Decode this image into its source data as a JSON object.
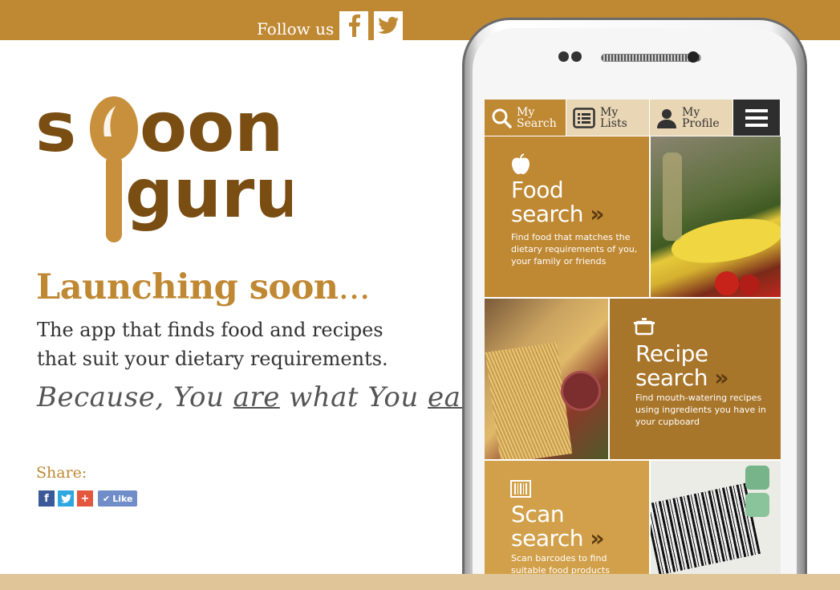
{
  "header": {
    "follow_label": "Follow us",
    "facebook_icon": "facebook-icon",
    "twitter_icon": "twitter-icon"
  },
  "brand": {
    "logo_line1": "Spoon",
    "logo_line2": "guru",
    "primary_color": "#bf8833",
    "dark_brown": "#7a4e12"
  },
  "hero": {
    "launch": "Launching soon",
    "launch_dots": "...",
    "tagline": "The app that finds food and recipes that suit your dietary requirements.",
    "because_1": "Because, You ",
    "because_are": "are",
    "because_2": " what You ",
    "because_eat": "eat!"
  },
  "share": {
    "label": "Share:",
    "like_label": "Like"
  },
  "app": {
    "nav": [
      {
        "line1": "My",
        "line2": "Search",
        "icon": "search-icon"
      },
      {
        "line1": "My",
        "line2": "Lists",
        "icon": "list-icon"
      },
      {
        "line1": "My",
        "line2": "Profile",
        "icon": "profile-icon"
      },
      {
        "icon": "menu-icon"
      }
    ],
    "tiles": [
      {
        "title_1": "Food",
        "title_2": "search",
        "arrow": "»",
        "desc": "Find food that matches the dietary requirements of you, your family or friends",
        "icon": "apple-icon"
      },
      {
        "title_1": "Recipe",
        "title_2": "search",
        "arrow": "»",
        "desc": "Find mouth-watering recipes using ingredients you have in your cupboard",
        "icon": "pot-icon"
      },
      {
        "title_1": "Scan",
        "title_2": "search",
        "arrow": "»",
        "desc": "Scan barcodes to find suitable food products",
        "icon": "barcode-icon"
      }
    ]
  }
}
